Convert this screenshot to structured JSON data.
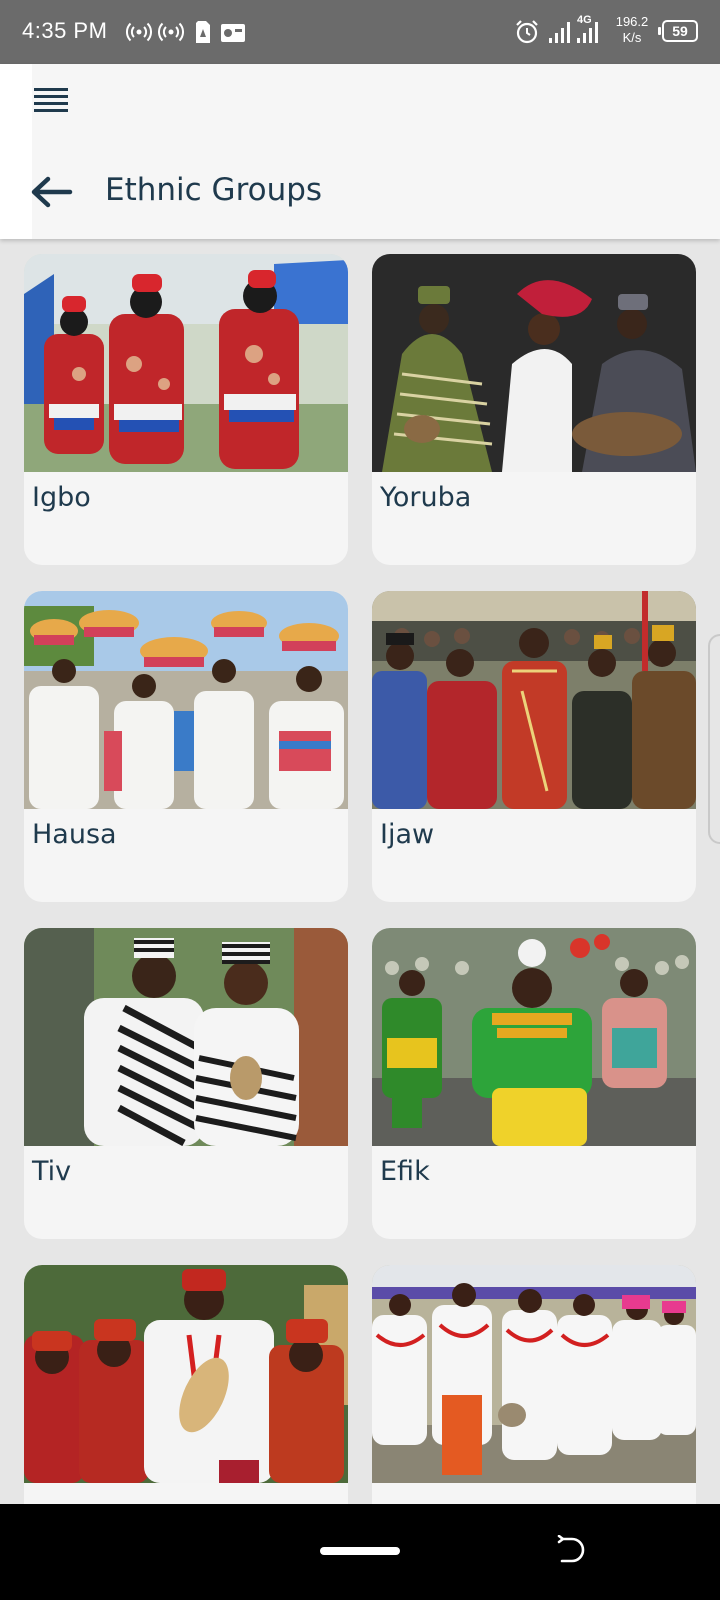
{
  "status_bar": {
    "time": "4:35 PM",
    "net_speed_value": "196.2",
    "net_speed_unit": "K/s",
    "battery": "59",
    "network_type": "4G",
    "icons": [
      "hotspot-icon",
      "hotspot-icon",
      "sim-download-icon",
      "radio-icon",
      "alarm-icon",
      "signal-icon",
      "signal-4g-icon",
      "battery-icon"
    ]
  },
  "header": {
    "title": "Ethnic Groups",
    "menu_icon": "menu-lines-icon",
    "back_icon": "arrow-left-icon"
  },
  "groups": [
    {
      "name": "Igbo"
    },
    {
      "name": "Yoruba"
    },
    {
      "name": "Hausa"
    },
    {
      "name": "Ijaw"
    },
    {
      "name": "Tiv"
    },
    {
      "name": "Efik"
    },
    {
      "name": ""
    },
    {
      "name": ""
    }
  ],
  "colors": {
    "title": "#1f3a4d",
    "background": "#e6e6e6",
    "card": "#f5f5f5"
  }
}
